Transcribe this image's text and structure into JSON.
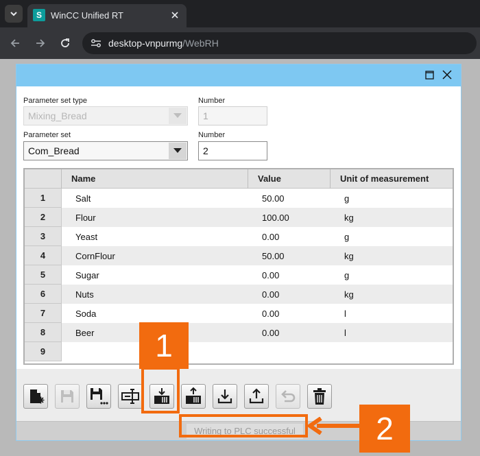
{
  "browser": {
    "tab_title": "WinCC Unified RT",
    "tab_favicon": "S",
    "url_host": "desktop-vnpurmg",
    "url_path": "/WebRH"
  },
  "dialog": {
    "param_type_label": "Parameter set type",
    "param_type_value": "Mixing_Bread",
    "number1_label": "Number",
    "number1_value": "1",
    "param_set_label": "Parameter set",
    "param_set_value": "Com_Bread",
    "number2_label": "Number",
    "number2_value": "2"
  },
  "table": {
    "headers": [
      "Name",
      "Value",
      "Unit of measurement"
    ],
    "rows": [
      {
        "num": "1",
        "name": "Salt",
        "value": "50.00",
        "unit": "g"
      },
      {
        "num": "2",
        "name": "Flour",
        "value": "100.00",
        "unit": "kg"
      },
      {
        "num": "3",
        "name": "Yeast",
        "value": "0.00",
        "unit": "g"
      },
      {
        "num": "4",
        "name": "CornFlour",
        "value": "50.00",
        "unit": "kg"
      },
      {
        "num": "5",
        "name": "Sugar",
        "value": "0.00",
        "unit": "g"
      },
      {
        "num": "6",
        "name": "Nuts",
        "value": "0.00",
        "unit": "kg"
      },
      {
        "num": "7",
        "name": "Soda",
        "value": "0.00",
        "unit": "l"
      },
      {
        "num": "8",
        "name": "Beer",
        "value": "0.00",
        "unit": "l"
      },
      {
        "num": "9",
        "name": "",
        "value": "",
        "unit": ""
      }
    ]
  },
  "toolbar_icons": [
    "new-recipe-icon",
    "save-icon",
    "save-as-icon",
    "rename-icon",
    "write-to-plc-icon",
    "read-from-plc-icon",
    "import-icon",
    "export-icon",
    "undo-icon",
    "delete-icon"
  ],
  "status": "Writing to PLC successful",
  "callouts": {
    "first": "1",
    "second": "2"
  },
  "colors": {
    "accent": "#f26b0f",
    "title_bar": "#7ec8f2"
  }
}
